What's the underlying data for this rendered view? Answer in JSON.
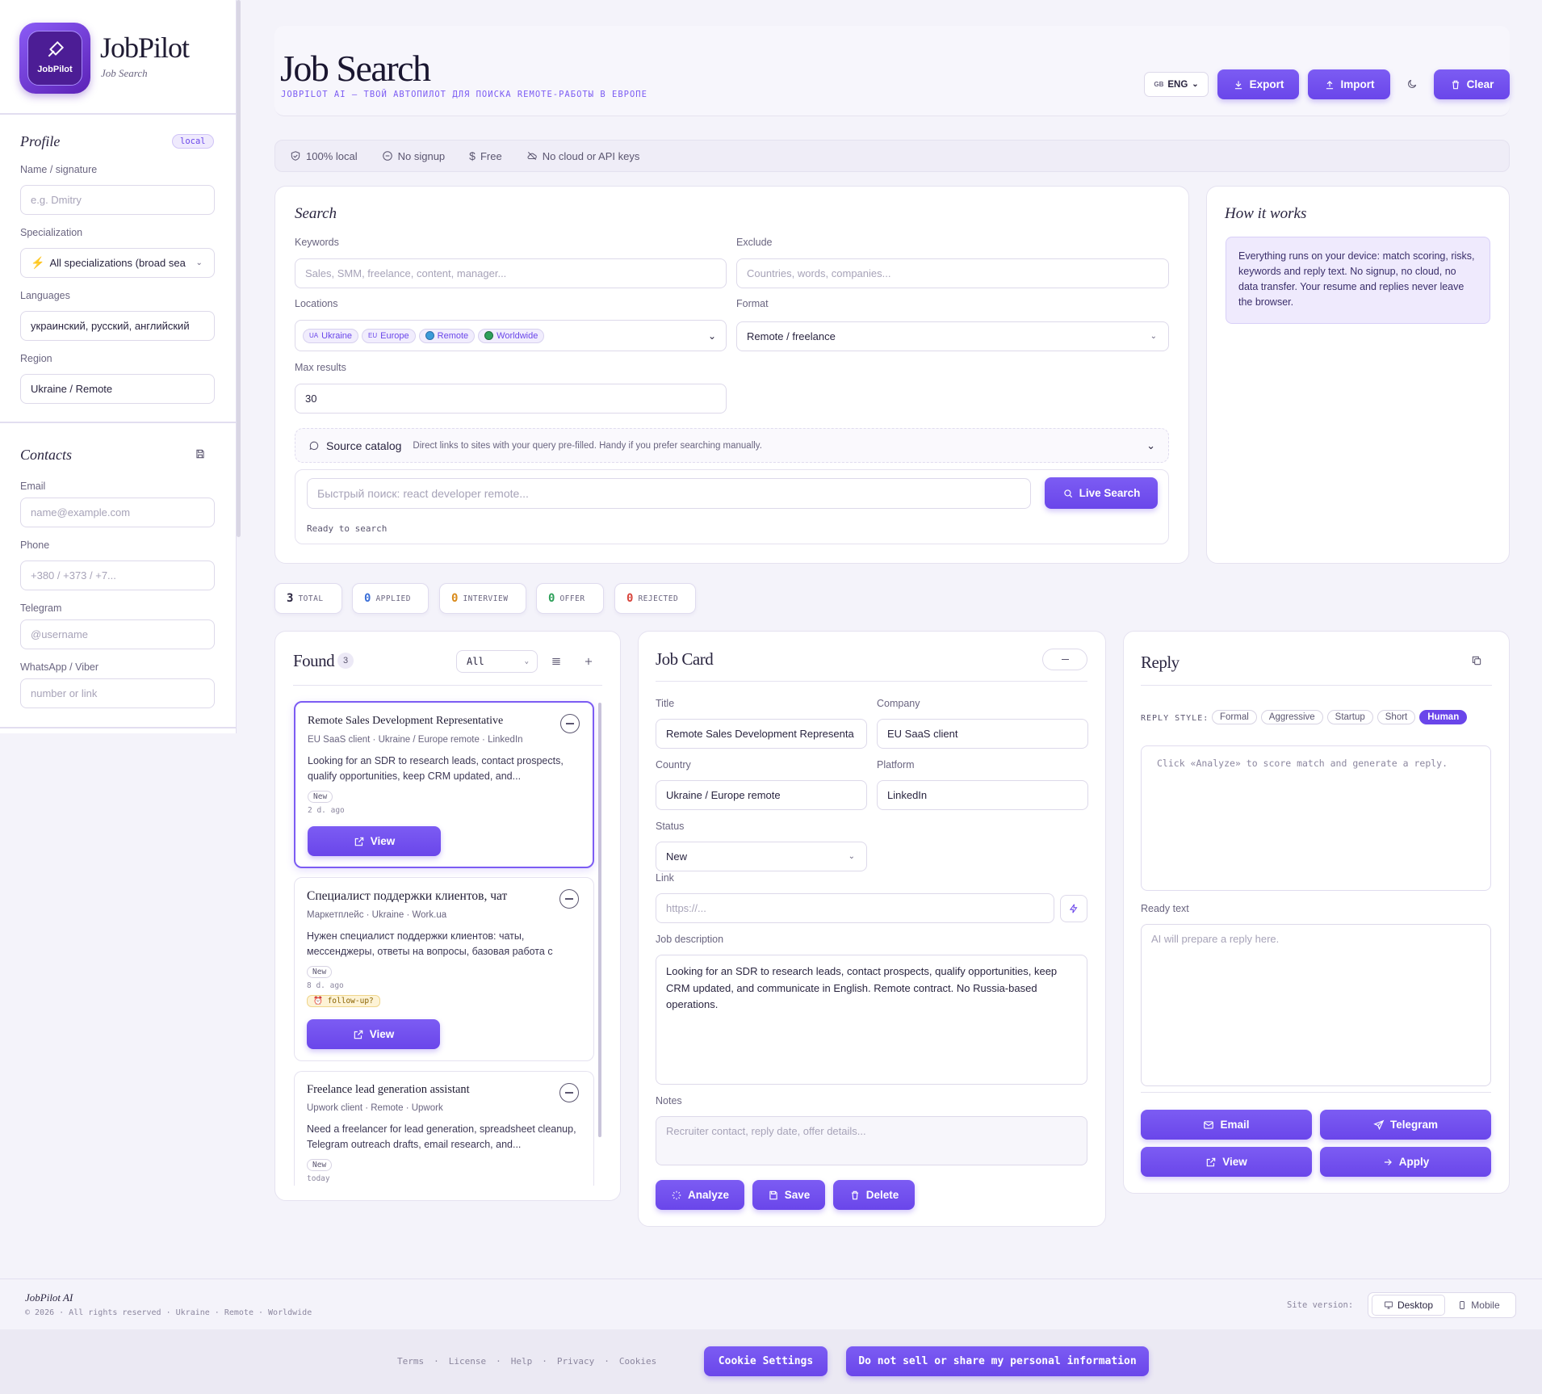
{
  "brand": {
    "logo_text": "JobPilot",
    "name": "JobPilot",
    "subtitle": "Job Search"
  },
  "header": {
    "title": "Job Search",
    "tagline": "JOBPILOT AI — ТВОЙ АВТОПИЛОТ ДЛЯ ПОИСКА REMOTE-РАБОТЫ В ЕВРОПЕ",
    "lang_flag": "GB",
    "lang": "ENG",
    "export": "Export",
    "import": "Import",
    "clear": "Clear"
  },
  "features": [
    "100% local",
    "No signup",
    "Free",
    "No cloud or API keys"
  ],
  "profile": {
    "title": "Profile",
    "badge": "local",
    "name_label": "Name / signature",
    "name_ph": "e.g. Dmitry",
    "spec_label": "Specialization",
    "spec_value": "All specializations (broad sea",
    "lang_label": "Languages",
    "lang_value": "украинский, русский, английский",
    "region_label": "Region",
    "region_value": "Ukraine / Remote"
  },
  "contacts": {
    "title": "Contacts",
    "email_label": "Email",
    "email_ph": "name@example.com",
    "phone_label": "Phone",
    "phone_ph": "+380 / +373 / +7...",
    "tg_label": "Telegram",
    "tg_ph": "@username",
    "wa_label": "WhatsApp / Viber",
    "wa_ph": "number or link"
  },
  "search": {
    "title": "Search",
    "kw_label": "Keywords",
    "kw_ph": "Sales, SMM, freelance, content, manager...",
    "ex_label": "Exclude",
    "ex_ph": "Countries, words, companies...",
    "loc_label": "Locations",
    "locations": [
      {
        "flag": "UA",
        "name": "Ukraine"
      },
      {
        "flag": "EU",
        "name": "Europe"
      },
      {
        "flag": "",
        "name": "Remote"
      },
      {
        "flag": "",
        "name": "Worldwide"
      }
    ],
    "fmt_label": "Format",
    "fmt_value": "Remote / freelance",
    "max_label": "Max results",
    "max_value": "30",
    "catalog_title": "Source catalog",
    "catalog_desc": "Direct links to sites with your query pre-filled. Handy if you prefer searching manually.",
    "quick_ph": "Быстрый поиск: react developer remote...",
    "live": "Live Search",
    "status": "Ready to search"
  },
  "how": {
    "title": "How it works",
    "text": "Everything runs on your device: match scoring, risks, keywords and reply text. No signup, no cloud, no data transfer. Your resume and replies never leave the browser."
  },
  "stats": [
    {
      "n": "3",
      "t": "TOTAL",
      "c": "#2a2540"
    },
    {
      "n": "0",
      "t": "APPLIED",
      "c": "#3b6fd8"
    },
    {
      "n": "0",
      "t": "INTERVIEW",
      "c": "#d98a1a"
    },
    {
      "n": "0",
      "t": "OFFER",
      "c": "#2ea05a"
    },
    {
      "n": "0",
      "t": "REJECTED",
      "c": "#d8443b"
    }
  ],
  "found": {
    "title": "Found",
    "count": "3",
    "filter": "All",
    "view": "View",
    "jobs": [
      {
        "title": "Remote Sales Development Representative",
        "meta": "EU SaaS client · Ukraine / Europe remote · LinkedIn",
        "desc": "Looking for an SDR to research leads, contact prospects, qualify opportunities, keep CRM updated, and...",
        "badge": "New",
        "ago": "2 d. ago"
      },
      {
        "title": "Специалист поддержки клиентов, чат",
        "meta": "Маркетплейс · Ukraine · Work.ua",
        "desc": "Нужен специалист поддержки клиентов: чаты, мессенджеры, ответы на вопросы, базовая работа с CRM...",
        "badge": "New",
        "ago": "8 d. ago",
        "tag": "follow-up?"
      },
      {
        "title": "Freelance lead generation assistant",
        "meta": "Upwork client · Remote · Upwork",
        "desc": "Need a freelancer for lead generation, spreadsheet cleanup, Telegram outreach drafts, email research, and...",
        "badge": "New",
        "ago": "today"
      }
    ]
  },
  "jobcard": {
    "title": "Job Card",
    "title_label": "Title",
    "title_value": "Remote Sales Development Representa",
    "company_label": "Company",
    "company_value": "EU SaaS client",
    "country_label": "Country",
    "country_value": "Ukraine / Europe remote",
    "platform_label": "Platform",
    "platform_value": "LinkedIn",
    "status_label": "Status",
    "status_value": "New",
    "link_label": "Link",
    "link_ph": "https://...",
    "desc_label": "Job description",
    "desc_value": "Looking for an SDR to research leads, contact prospects, qualify opportunities, keep CRM updated, and communicate in English. Remote contract. No Russia-based operations.",
    "notes_label": "Notes",
    "notes_ph": "Recruiter contact, reply date, offer details...",
    "analyze": "Analyze",
    "save": "Save",
    "delete": "Delete"
  },
  "reply": {
    "title": "Reply",
    "style_label": "REPLY STYLE:",
    "styles": [
      "Formal",
      "Aggressive",
      "Startup",
      "Short",
      "Human"
    ],
    "active_style": "Human",
    "analysis_ph": "Click «Analyze» to score match and generate a reply.",
    "ready_label": "Ready text",
    "ready_ph": "AI will prepare a reply here.",
    "email": "Email",
    "telegram": "Telegram",
    "view": "View",
    "apply": "Apply"
  },
  "footer": {
    "brand": "JobPilot AI",
    "copy": "© 2026 · All rights reserved · Ukraine · Remote · Worldwide",
    "version_label": "Site version:",
    "desktop": "Desktop",
    "mobile": "Mobile",
    "links": [
      "Terms",
      "License",
      "Help",
      "Privacy",
      "Cookies"
    ],
    "cookie": "Cookie Settings",
    "dns": "Do not sell or share my personal information"
  }
}
